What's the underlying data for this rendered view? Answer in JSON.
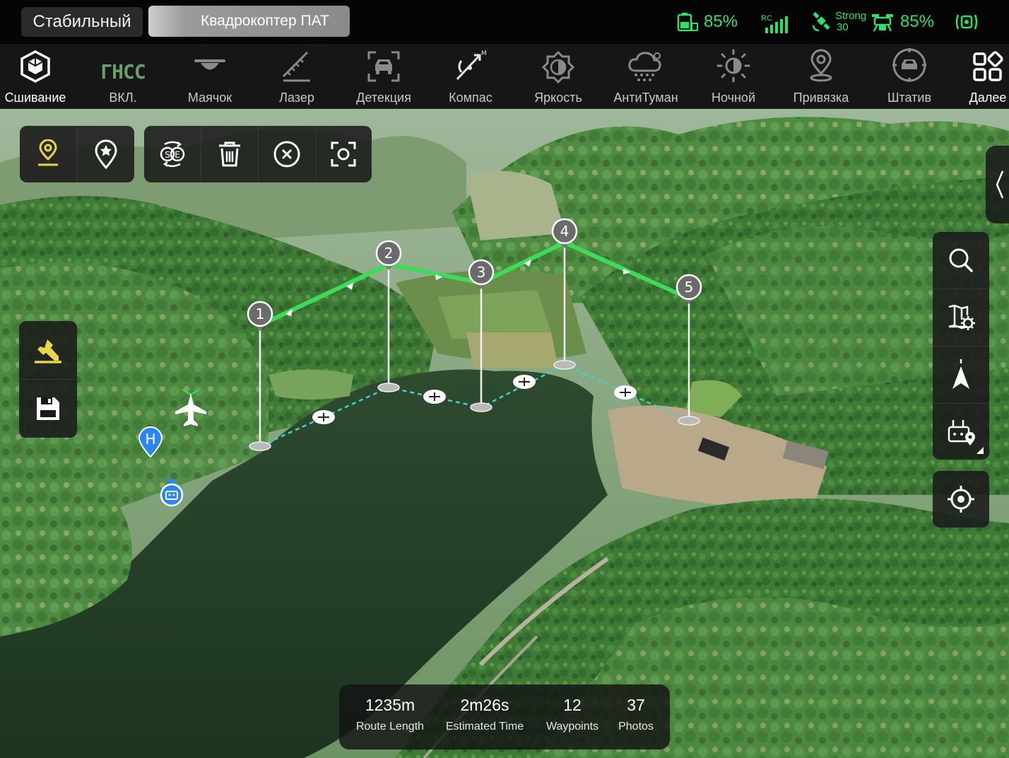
{
  "status_bar": {
    "flight_mode": "Стабильный",
    "device_name": "Квадрокоптер ПАТ",
    "battery_percent": "85%",
    "rc_label": "RC",
    "gps_strength": "Strong",
    "satellite_count": "30",
    "aircraft_battery_percent": "85%",
    "accent_color": "#2ee06a"
  },
  "toolbar": {
    "items": [
      {
        "label": "Сшивание",
        "icon": "stitch-cube-icon",
        "active": true
      },
      {
        "label": "ВКЛ.",
        "icon": "gnss-icon",
        "icon_text": "ГНСС"
      },
      {
        "label": "Маячок",
        "icon": "beacon-icon"
      },
      {
        "label": "Лазер",
        "icon": "laser-ruler-icon"
      },
      {
        "label": "Детекция",
        "icon": "car-detection-icon"
      },
      {
        "label": "Компас",
        "icon": "compass-calibration-icon"
      },
      {
        "label": "Яркость",
        "icon": "brightness-icon"
      },
      {
        "label": "АнтиТуман",
        "icon": "defog-icon"
      },
      {
        "label": "Ночной",
        "icon": "night-mode-icon"
      },
      {
        "label": "Привязка",
        "icon": "location-pin-icon"
      },
      {
        "label": "Штатив",
        "icon": "tripod-icon"
      },
      {
        "label": "Далее",
        "icon": "more-grid-icon"
      }
    ]
  },
  "map": {
    "waypoints": [
      "1",
      "2",
      "3",
      "4",
      "5"
    ],
    "home_marker": "H",
    "route_color": "#3cdc5a",
    "ground_path_color": "#38d6c8"
  },
  "route_stats": {
    "route_length_value": "1235m",
    "route_length_label": "Route Length",
    "estimated_time_value": "2m26s",
    "estimated_time_label": "Estimated Time",
    "waypoints_value": "12",
    "waypoints_label": "Waypoints",
    "photos_value": "37",
    "photos_label": "Photos"
  }
}
